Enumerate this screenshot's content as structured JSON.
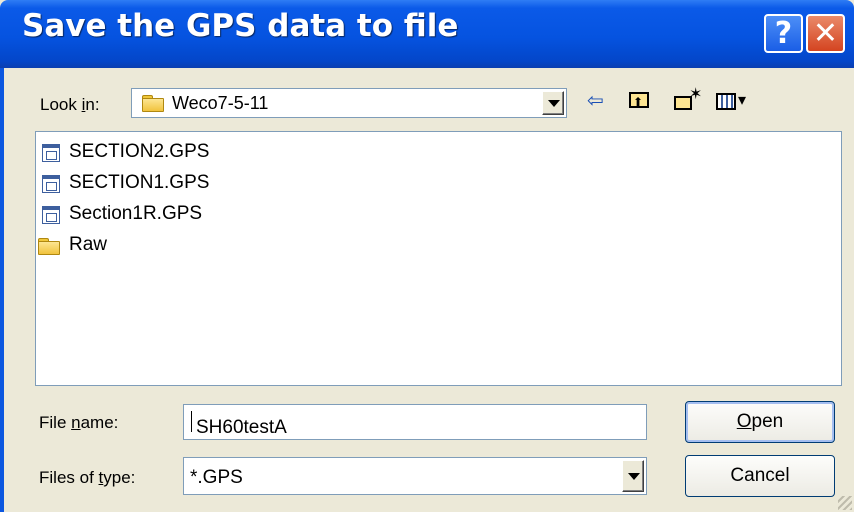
{
  "window": {
    "title": "Save the GPS data to file",
    "help_glyph": "?",
    "close_glyph": "✕"
  },
  "look_in": {
    "label_pre": "Look ",
    "label_key": "i",
    "label_post": "n:",
    "value": "Weco7-5-11"
  },
  "toolbar": {
    "back_glyph": "⇦",
    "up_glyph": "⬆",
    "new_folder_glyph": "✶",
    "views_glyph": "▾"
  },
  "files": [
    {
      "name": "SECTION2.GPS",
      "icon": "gps-file-icon"
    },
    {
      "name": "SECTION1.GPS",
      "icon": "gps-file-icon"
    },
    {
      "name": "Section1R.GPS",
      "icon": "gps-file-icon"
    },
    {
      "name": "Raw",
      "icon": "folder-icon"
    }
  ],
  "filename": {
    "label_pre": "File ",
    "label_key": "n",
    "label_post": "ame:",
    "value": "SH60testA"
  },
  "filetype": {
    "label_pre": "Files of ",
    "label_key": "t",
    "label_post": "ype:",
    "value": "*.GPS"
  },
  "buttons": {
    "open_key": "O",
    "open_rest": "pen",
    "cancel": "Cancel"
  },
  "colors": {
    "titlebar": "#0553e0",
    "dialog_bg": "#ece9d8",
    "close_button": "#d44420"
  }
}
